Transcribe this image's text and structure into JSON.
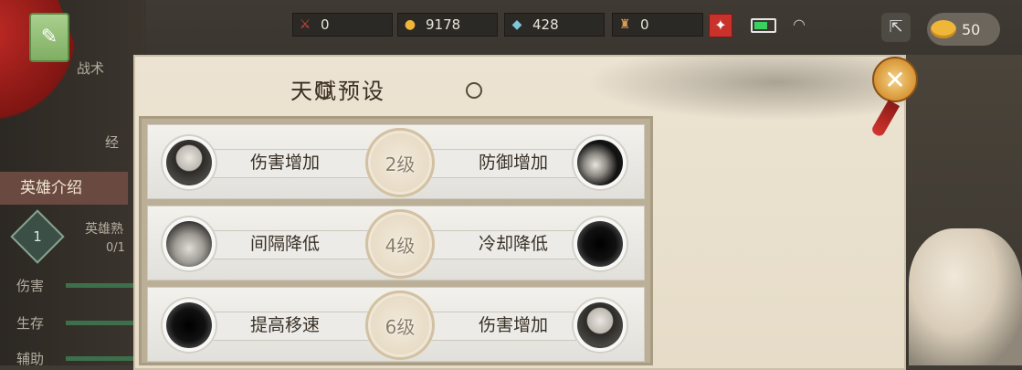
{
  "topbar": {
    "resources": [
      {
        "name": "sword",
        "value": "0"
      },
      {
        "name": "gold",
        "value": "9178"
      },
      {
        "name": "gem",
        "value": "428"
      },
      {
        "name": "tower",
        "value": "0"
      }
    ],
    "coins": "50"
  },
  "sidebar": {
    "tab_label": "英雄介绍",
    "hero_proficiency": "英雄熟",
    "proficiency_value": "0/1",
    "level": "1",
    "stat_damage": "伤害",
    "stat_survival": "生存",
    "stat_support": "辅助",
    "tactics_label": "战术",
    "exp_label": "经"
  },
  "dialog": {
    "title": "天赋预设",
    "talents": [
      {
        "left": "伤害增加",
        "level": "2级",
        "right": "防御增加"
      },
      {
        "left": "间隔降低",
        "level": "4级",
        "right": "冷却降低"
      },
      {
        "left": "提高移速",
        "level": "6级",
        "right": "伤害增加"
      }
    ]
  },
  "colors": {
    "panel_bg": "#ece3d2",
    "accent_red": "#c8322b",
    "text_dark": "#3a3127"
  },
  "icons": [
    "sword-icon",
    "gold-icon",
    "gem-icon",
    "tower-icon",
    "plus-icon",
    "battery-icon",
    "wifi-icon",
    "share-icon",
    "coin-icon",
    "close-icon"
  ]
}
